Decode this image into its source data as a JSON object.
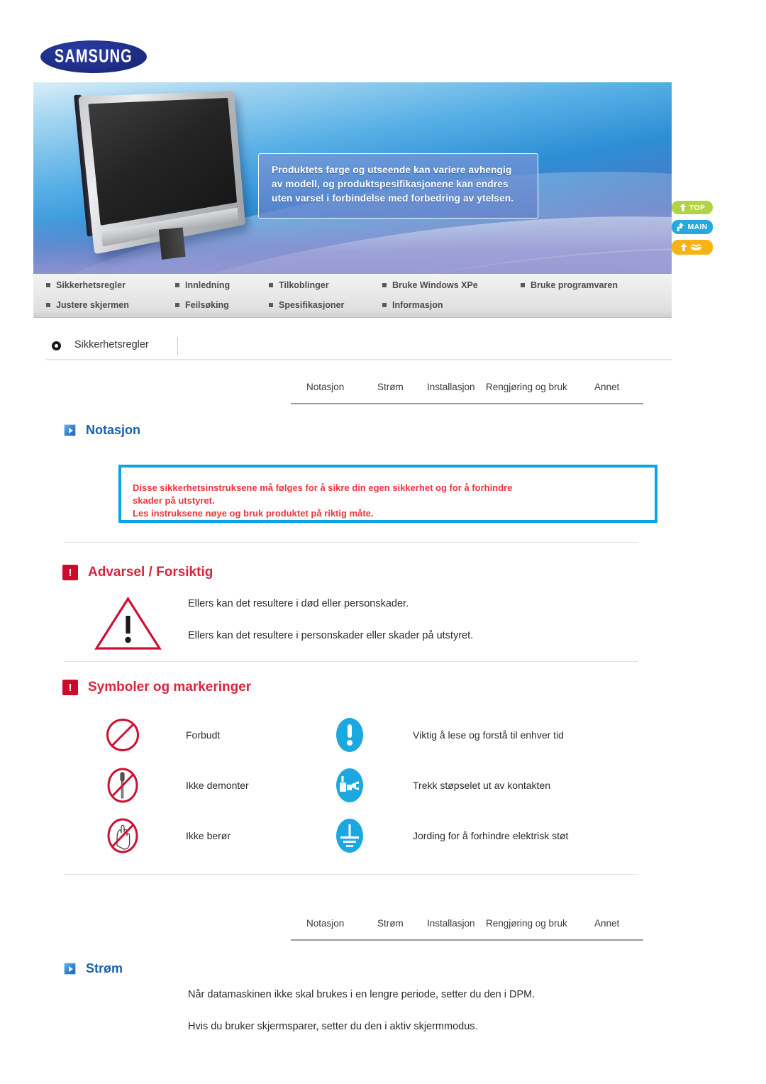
{
  "brand": {
    "logo_text": "SAMSUNG"
  },
  "banner": {
    "notice_lines": [
      "Produktets farge og utseende kan variere avhengig",
      "av modell, og produktspesifikasjonene kan endres",
      "uten varsel i forbindelse med forbedring av ytelsen."
    ],
    "float_buttons": [
      {
        "label": "TOP",
        "icon": "up-arrow-icon",
        "color": "#b3d24a"
      },
      {
        "label": "MAIN",
        "icon": "branch-arrow-icon",
        "color": "#26a9e0"
      },
      {
        "label": "",
        "icon": "up-arrow-book-icon",
        "color": "#f5b315"
      }
    ]
  },
  "menu": {
    "row1": [
      "Sikkerhetsregler",
      "Innledning",
      "Tilkoblinger",
      "Bruke Windows XPe",
      "Bruke programvaren"
    ],
    "row2": [
      "Justere skjermen",
      "Feilsøking",
      "Spesifikasjoner",
      "Informasjon"
    ]
  },
  "breadcrumb": {
    "icon": "ring-icon",
    "title": "Sikkerhetsregler"
  },
  "tabs": [
    "Notasjon",
    "Strøm",
    "Installasjon",
    "Rengjøring og bruk",
    "Annet"
  ],
  "sections": {
    "notasjon": {
      "icon": "blue-arrow-icon",
      "title": "Notasjon",
      "warning_lines": [
        "Disse sikkerhetsinstruksene må følges for å sikre din egen sikkerhet og for å forhindre",
        "skader på utstyret.",
        "Les instruksene nøye og bruk produktet på riktig måte."
      ]
    },
    "advarsel": {
      "icon": "red-exclamation-icon",
      "title": "Advarsel / Forsiktig",
      "triangle_icon": "warning-triangle-icon",
      "lines": [
        "Ellers kan det resultere i død eller personskader.",
        "Ellers kan det resultere i personskader eller skader på utstyret."
      ]
    },
    "symboler": {
      "icon": "red-exclamation-icon",
      "title": "Symboler og markeringer",
      "rows": [
        {
          "left": {
            "icon": "prohibited-icon",
            "label": "Forbudt"
          },
          "right": {
            "icon": "info-exclamation-icon",
            "label": "Viktig å lese og forstå til enhver tid"
          }
        },
        {
          "left": {
            "icon": "no-disassemble-icon",
            "label": "Ikke demonter"
          },
          "right": {
            "icon": "unplug-icon",
            "label": "Trekk støpselet ut av kontakten"
          }
        },
        {
          "left": {
            "icon": "no-touch-icon",
            "label": "Ikke berør"
          },
          "right": {
            "icon": "ground-icon",
            "label": "Jording for å forhindre elektrisk støt"
          }
        }
      ]
    },
    "strom": {
      "icon": "blue-arrow-icon",
      "title": "Strøm",
      "lines": [
        "Når datamaskinen ikke skal brukes i en lengre periode, setter du den i DPM.",
        "Hvis du bruker skjermsparer, setter du den i aktiv skjermmodus."
      ]
    }
  },
  "colors": {
    "brand_blue": "#1b2c8a",
    "heading_blue": "#1a5faa",
    "heading_red": "#d8243c",
    "warning_red": "#f0343c",
    "box_border_blue": "#0aa3e8",
    "prohibit_red": "#cc1133",
    "info_blue": "#1ba8e0"
  }
}
